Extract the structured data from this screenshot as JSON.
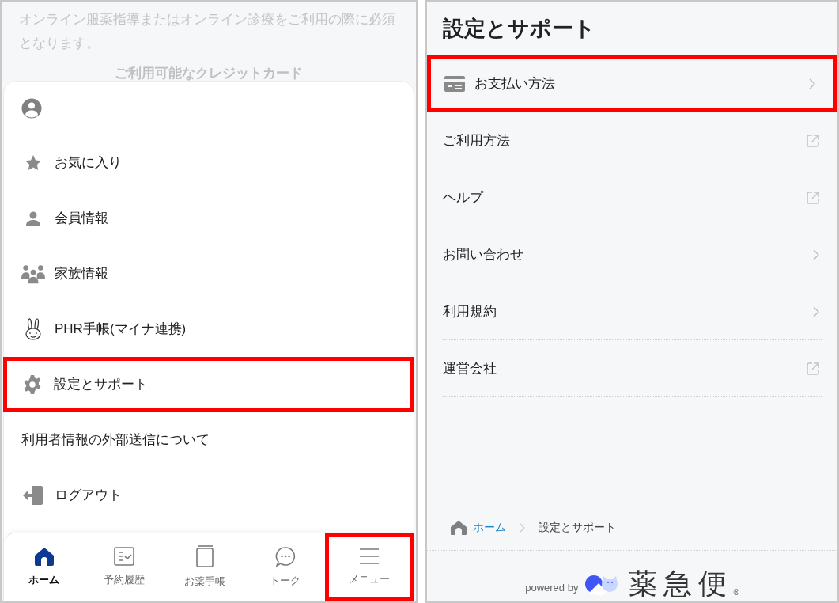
{
  "left_screen": {
    "background_text": "オンライン服薬指導またはオンライン診療をご利用の際に必須となります。",
    "background_heading": "ご利用可能なクレジットカード",
    "menu": [
      {
        "label": "お気に入り",
        "highlighted": false
      },
      {
        "label": "会員情報",
        "highlighted": false
      },
      {
        "label": "家族情報",
        "highlighted": false
      },
      {
        "label": "PHR手帳(マイナ連携)",
        "highlighted": false
      },
      {
        "label": "設定とサポート",
        "highlighted": true
      },
      {
        "label": "利用者情報の外部送信について",
        "highlighted": false
      },
      {
        "label": "ログアウト",
        "highlighted": false
      }
    ],
    "nav": [
      {
        "label": "ホーム",
        "selected": true,
        "highlighted": false
      },
      {
        "label": "予約履歴",
        "selected": false,
        "highlighted": false
      },
      {
        "label": "お薬手帳",
        "selected": false,
        "highlighted": false
      },
      {
        "label": "トーク",
        "selected": false,
        "highlighted": false
      },
      {
        "label": "メニュー",
        "selected": false,
        "highlighted": true
      }
    ]
  },
  "right_screen": {
    "title": "設定とサポート",
    "items": [
      {
        "label": "お支払い方法",
        "kind": "link",
        "highlighted": true
      },
      {
        "label": "ご利用方法",
        "kind": "external",
        "highlighted": false
      },
      {
        "label": "ヘルプ",
        "kind": "external",
        "highlighted": false
      },
      {
        "label": "お問い合わせ",
        "kind": "link",
        "highlighted": false
      },
      {
        "label": "利用規約",
        "kind": "link",
        "highlighted": false
      },
      {
        "label": "運営会社",
        "kind": "external",
        "highlighted": false
      }
    ],
    "breadcrumb": [
      "ホーム",
      "設定とサポート"
    ],
    "footer": {
      "powered_by": "powered by",
      "logo_text": "薬急便",
      "logo_mark": "®"
    }
  }
}
